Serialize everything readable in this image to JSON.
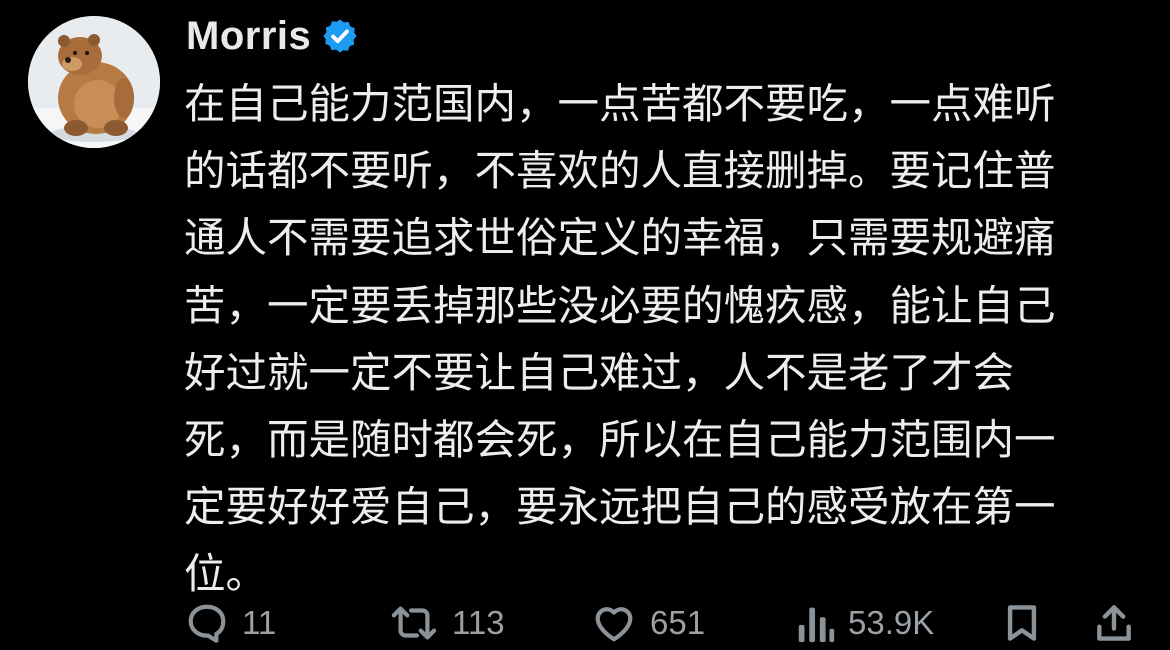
{
  "post": {
    "author": "Morris",
    "text_lines": [
      "在自己能力范国内，一点苦都不要吃，一点难听",
      "的话都不要听，不喜欢的人直接删掉。要记住普",
      "通人不需要追求世俗定义的幸福，只需要规避痛",
      "苦，一定要丢掉那些没必要的愧疚感，能让自己",
      "好过就一定不要让自己难过，人不是老了才会",
      "死，而是随时都会死，所以在自己能力范围内一",
      "定要好好爱自己，要永远把自己的感受放在第一",
      "位。"
    ]
  },
  "actions": {
    "reply_count": "11",
    "repost_count": "113",
    "like_count": "651",
    "views_count": "53.9K"
  },
  "icons": {
    "verified": "verified-badge-icon",
    "reply": "speech-bubble-icon",
    "repost": "repost-arrows-icon",
    "like": "heart-icon",
    "views": "bar-chart-icon",
    "bookmark": "bookmark-icon",
    "share": "share-upload-icon"
  },
  "colors": {
    "background": "#000000",
    "text": "#e7e9ea",
    "muted": "#8b9298",
    "verified": "#1d9bf0"
  }
}
